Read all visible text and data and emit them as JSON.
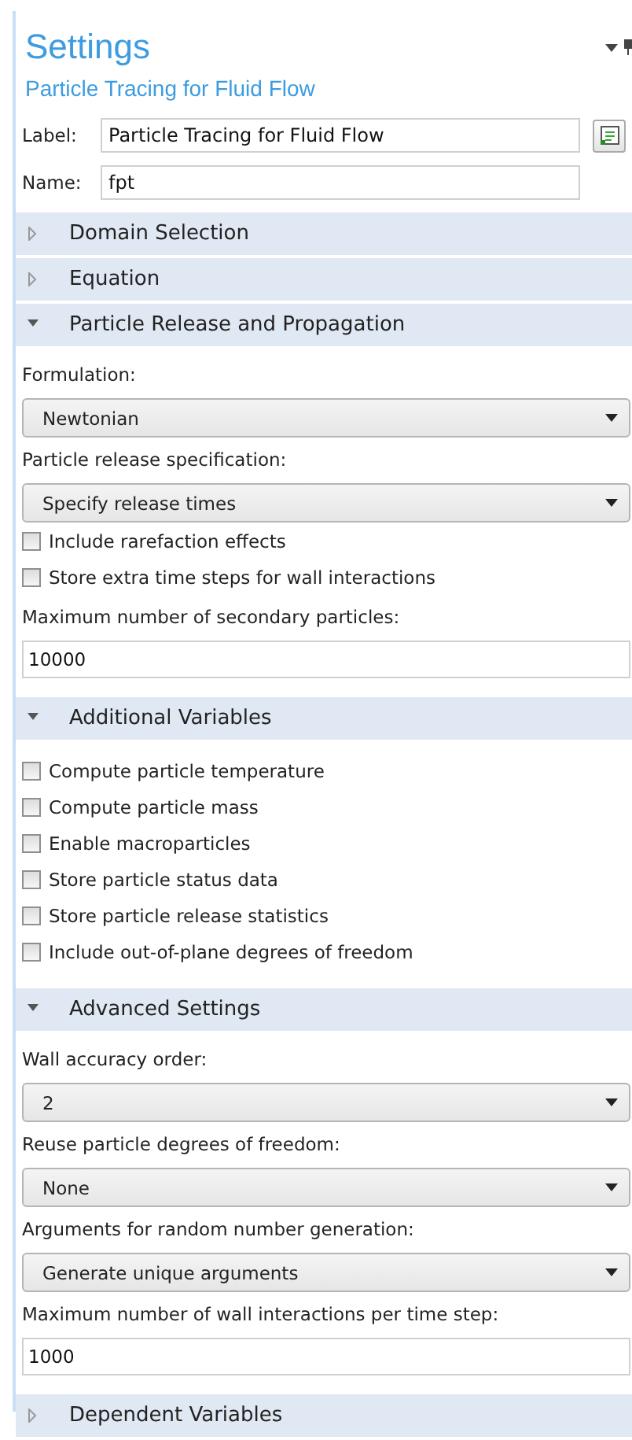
{
  "panel": {
    "title": "Settings",
    "subtitle": "Particle Tracing for Fluid Flow"
  },
  "fields": [
    {
      "label": "Label:",
      "value": "Particle Tracing for Fluid Flow",
      "kind": "label"
    },
    {
      "label": "Name:",
      "value": "fpt",
      "kind": "name"
    }
  ],
  "sections": [
    {
      "title": "Domain Selection",
      "expanded": false
    },
    {
      "title": "Equation",
      "expanded": false
    },
    {
      "title": "Particle Release and Propagation",
      "expanded": true,
      "items": [
        {
          "kind": "select",
          "label": "Formulation:",
          "value": "Newtonian"
        },
        {
          "kind": "select",
          "label": "Particle release specification:",
          "value": "Specify release times"
        },
        {
          "kind": "checkbox",
          "text": "Include rarefaction effects",
          "checked": false
        },
        {
          "kind": "checkbox",
          "text": "Store extra time steps for wall interactions",
          "checked": false
        },
        {
          "kind": "number",
          "label": "Maximum number of secondary particles:",
          "value": "10000"
        }
      ]
    },
    {
      "title": "Additional Variables",
      "expanded": true,
      "items": [
        {
          "kind": "checkbox",
          "text": "Compute particle temperature",
          "checked": false
        },
        {
          "kind": "checkbox",
          "text": "Compute particle mass",
          "checked": false
        },
        {
          "kind": "checkbox",
          "text": "Enable macroparticles",
          "checked": false
        },
        {
          "kind": "checkbox",
          "text": "Store particle status data",
          "checked": false
        },
        {
          "kind": "checkbox",
          "text": "Store particle release statistics",
          "checked": false
        },
        {
          "kind": "checkbox",
          "text": "Include out-of-plane degrees of freedom",
          "checked": false
        }
      ]
    },
    {
      "title": "Advanced Settings",
      "expanded": true,
      "items": [
        {
          "kind": "select",
          "label": "Wall accuracy order:",
          "value": "2"
        },
        {
          "kind": "select",
          "label": "Reuse particle degrees of freedom:",
          "value": "None"
        },
        {
          "kind": "select",
          "label": "Arguments for random number generation:",
          "value": "Generate unique arguments"
        },
        {
          "kind": "number",
          "label": "Maximum number of wall interactions per time step:",
          "value": "1000"
        }
      ]
    },
    {
      "title": "Dependent Variables",
      "expanded": false
    }
  ]
}
